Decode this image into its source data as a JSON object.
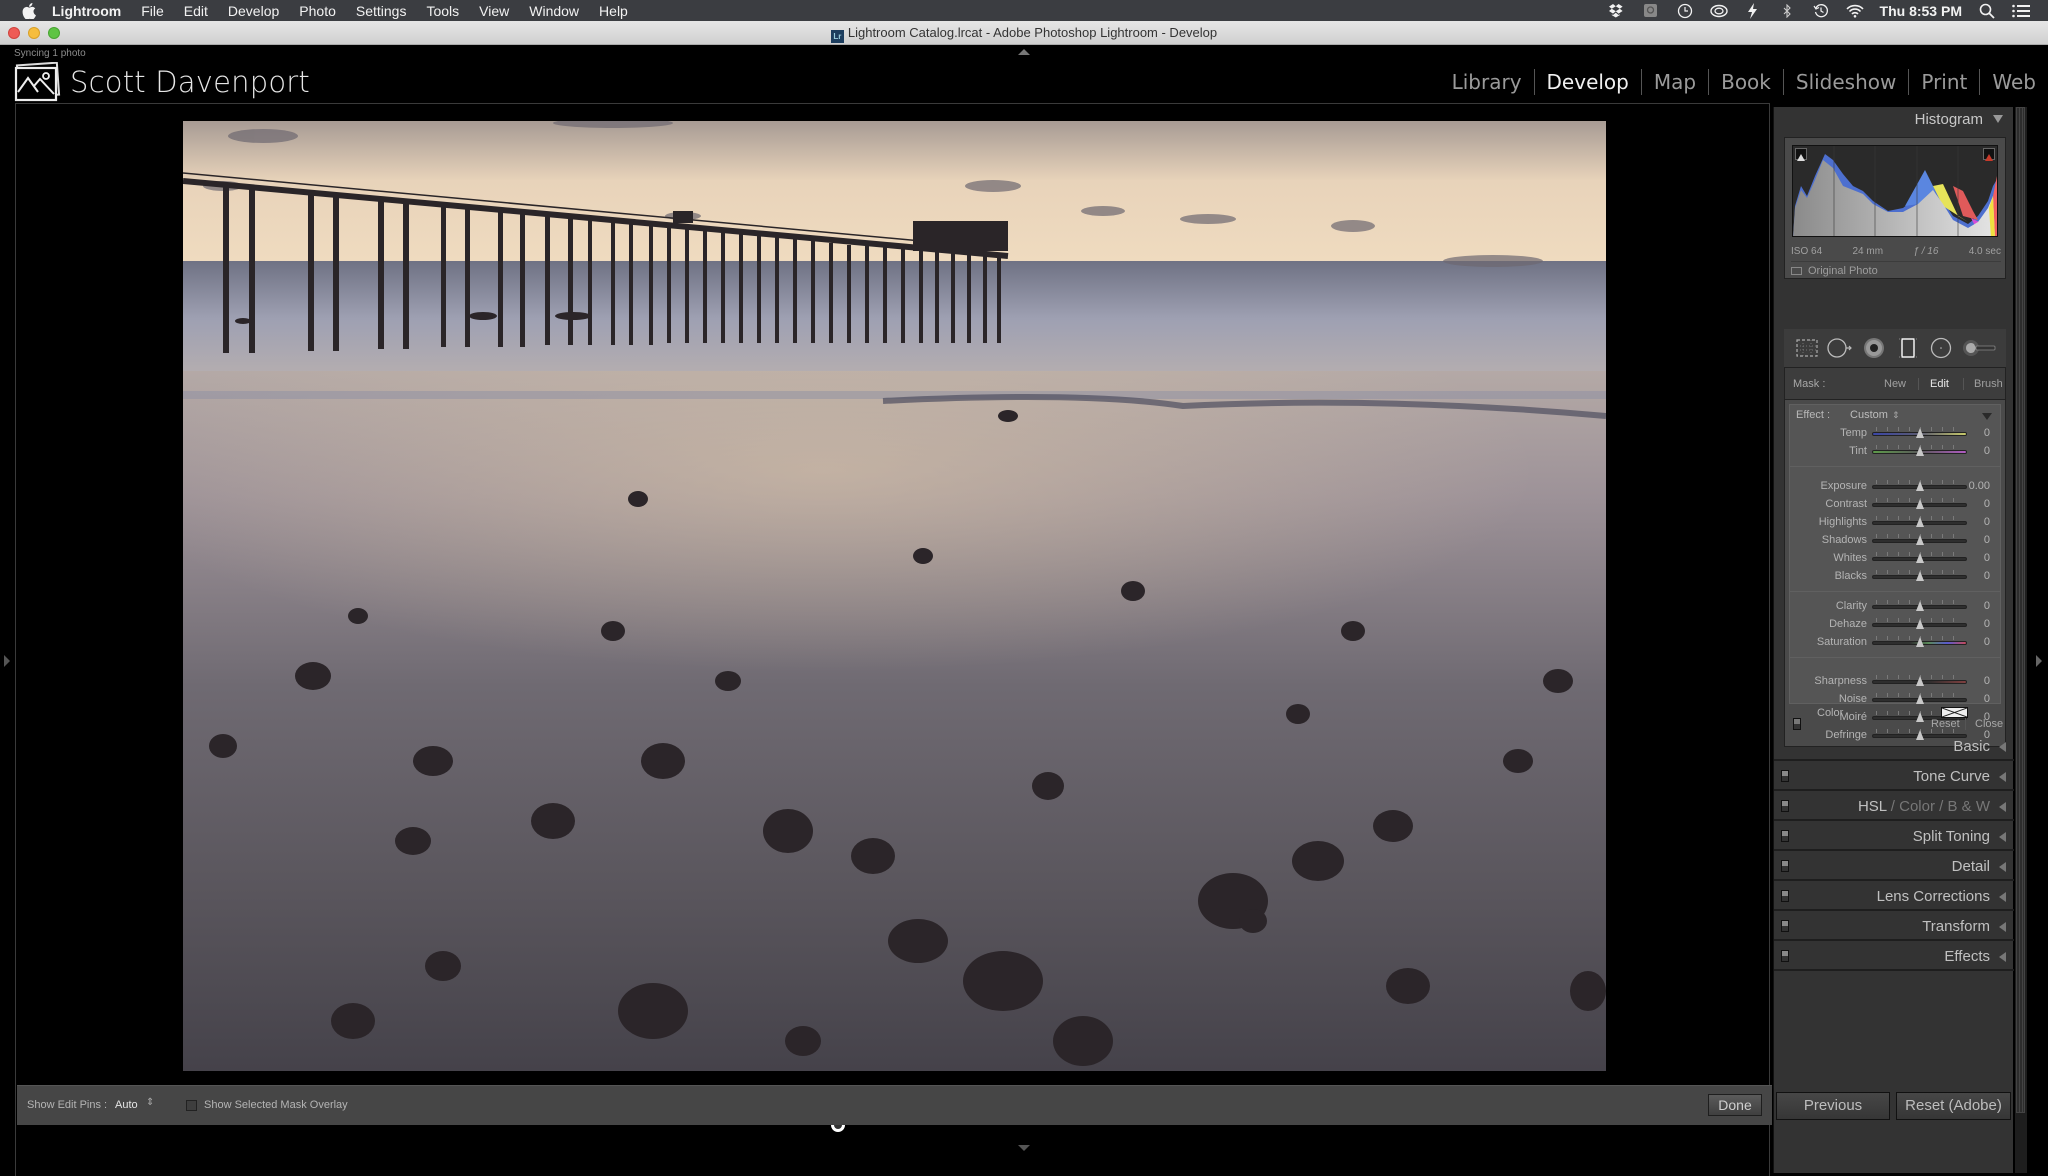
{
  "menubar": {
    "app_name": "Lightroom",
    "items": [
      "File",
      "Edit",
      "Develop",
      "Photo",
      "Settings",
      "Tools",
      "View",
      "Window",
      "Help"
    ],
    "status_icons": [
      "dropbox-icon",
      "disk-icon",
      "clock-icon",
      "creative-cloud-icon",
      "flash-icon",
      "bluetooth-icon",
      "time-machine-icon",
      "wifi-icon"
    ],
    "clock": "Thu 8:53 PM"
  },
  "window": {
    "title": "Lightroom Catalog.lrcat - Adobe Photoshop Lightroom - Develop",
    "badge": "Lr"
  },
  "identity": {
    "status": "Syncing 1 photo",
    "name": "Scott Davenport"
  },
  "modules": {
    "items": [
      "Library",
      "Develop",
      "Map",
      "Book",
      "Slideshow",
      "Print",
      "Web"
    ],
    "active": "Develop"
  },
  "photo": {
    "description": "Long-exposure sunset at a beach pier with wet sand and rocks",
    "colors": {
      "sky_top": "#c9b9a9",
      "sky_glow": "#efd8b5",
      "sea": "#8a8ca0",
      "sand_mid": "#6e6b72",
      "sand_dark": "#3a383d"
    }
  },
  "toolbar": {
    "edit_pins_label": "Show Edit Pins :",
    "edit_pins_value": "Auto",
    "mask_overlay_label": "Show Selected Mask Overlay",
    "mask_overlay_checked": false,
    "done_label": "Done"
  },
  "histogram": {
    "title": "Histogram",
    "iso": "ISO 64",
    "focal": "24 mm",
    "aperture": "ƒ / 16",
    "shutter": "4.0 sec",
    "original_photo_label": "Original Photo"
  },
  "tools": [
    "crop-overlay-icon",
    "spot-removal-icon",
    "red-eye-icon",
    "graduated-filter-icon",
    "radial-filter-icon",
    "adjustment-brush-icon"
  ],
  "mask": {
    "label": "Mask :",
    "options": [
      "New",
      "Edit",
      "Brush"
    ],
    "active": "Edit",
    "effect_label": "Effect :",
    "effect_value": "Custom",
    "groups": [
      [
        {
          "name": "Temp",
          "value": "0",
          "pos": 0.5
        },
        {
          "name": "Tint",
          "value": "0",
          "pos": 0.5
        }
      ],
      [
        {
          "name": "Exposure",
          "value": "0.00",
          "pos": 0.5
        },
        {
          "name": "Contrast",
          "value": "0",
          "pos": 0.5
        },
        {
          "name": "Highlights",
          "value": "0",
          "pos": 0.5
        },
        {
          "name": "Shadows",
          "value": "0",
          "pos": 0.5
        },
        {
          "name": "Whites",
          "value": "0",
          "pos": 0.5
        },
        {
          "name": "Blacks",
          "value": "0",
          "pos": 0.5
        }
      ],
      [
        {
          "name": "Clarity",
          "value": "0",
          "pos": 0.5
        },
        {
          "name": "Dehaze",
          "value": "0",
          "pos": 0.5
        },
        {
          "name": "Saturation",
          "value": "0",
          "pos": 0.5
        }
      ],
      [
        {
          "name": "Sharpness",
          "value": "0",
          "pos": 0.5
        },
        {
          "name": "Noise",
          "value": "0",
          "pos": 0.5
        },
        {
          "name": "Moiré",
          "value": "0",
          "pos": 0.5
        },
        {
          "name": "Defringe",
          "value": "0",
          "pos": 0.5
        }
      ]
    ],
    "color_label": "Color",
    "reset_label": "Reset",
    "close_label": "Close"
  },
  "sections": [
    {
      "id": "basic",
      "label": "Basic",
      "has_switch": false
    },
    {
      "id": "tone-curve",
      "label": "Tone Curve",
      "has_switch": true
    },
    {
      "id": "hsl",
      "label": "HSL",
      "extra": [
        "Color",
        "B & W"
      ],
      "has_switch": true
    },
    {
      "id": "split-toning",
      "label": "Split Toning",
      "has_switch": true
    },
    {
      "id": "detail",
      "label": "Detail",
      "has_switch": true
    },
    {
      "id": "lens-corrections",
      "label": "Lens Corrections",
      "has_switch": true
    },
    {
      "id": "transform",
      "label": "Transform",
      "has_switch": true
    },
    {
      "id": "effects",
      "label": "Effects",
      "has_switch": true
    }
  ],
  "buttons": {
    "previous": "Previous",
    "reset": "Reset (Adobe)"
  }
}
